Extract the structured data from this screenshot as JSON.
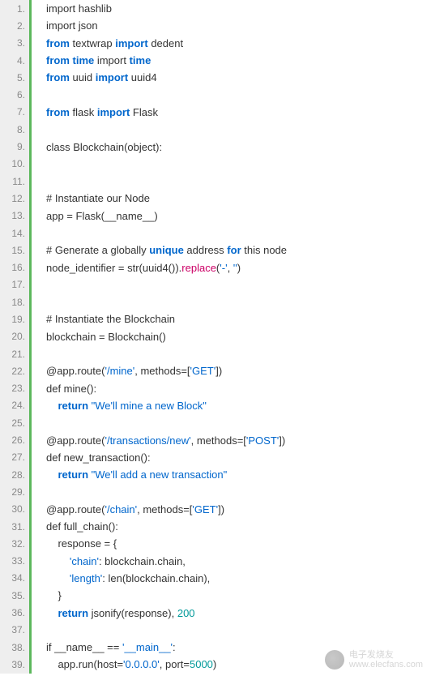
{
  "watermark": {
    "line1": "电子发烧友",
    "line2": "www.elecfans.com"
  },
  "lines": [
    {
      "n": "1.",
      "segs": [
        {
          "t": "import hashlib",
          "c": "plain"
        }
      ]
    },
    {
      "n": "2.",
      "segs": [
        {
          "t": "import json",
          "c": "plain"
        }
      ]
    },
    {
      "n": "3.",
      "segs": [
        {
          "t": "from ",
          "c": "kw"
        },
        {
          "t": "textwrap ",
          "c": "plain"
        },
        {
          "t": "import",
          "c": "kw2"
        },
        {
          "t": " dedent",
          "c": "plain"
        }
      ]
    },
    {
      "n": "4.",
      "segs": [
        {
          "t": "from time ",
          "c": "kw"
        },
        {
          "t": "import ",
          "c": "plain"
        },
        {
          "t": "time",
          "c": "kw3"
        }
      ]
    },
    {
      "n": "5.",
      "segs": [
        {
          "t": "from ",
          "c": "kw"
        },
        {
          "t": "uuid ",
          "c": "plain"
        },
        {
          "t": "import",
          "c": "kw2"
        },
        {
          "t": " uuid4",
          "c": "plain"
        }
      ]
    },
    {
      "n": "6.",
      "segs": [
        {
          "t": "",
          "c": "plain"
        }
      ]
    },
    {
      "n": "7.",
      "segs": [
        {
          "t": "from ",
          "c": "kw"
        },
        {
          "t": "flask ",
          "c": "plain"
        },
        {
          "t": "import",
          "c": "kw2"
        },
        {
          "t": " Flask",
          "c": "plain"
        }
      ]
    },
    {
      "n": "8.",
      "segs": [
        {
          "t": "",
          "c": "plain"
        }
      ]
    },
    {
      "n": "9.",
      "segs": [
        {
          "t": "class Blockchain(object):",
          "c": "plain"
        }
      ]
    },
    {
      "n": "10.",
      "segs": [
        {
          "t": "",
          "c": "plain"
        }
      ]
    },
    {
      "n": "11.",
      "segs": [
        {
          "t": "",
          "c": "plain"
        }
      ]
    },
    {
      "n": "12.",
      "segs": [
        {
          "t": "# Instantiate our Node",
          "c": "plain"
        }
      ]
    },
    {
      "n": "13.",
      "segs": [
        {
          "t": "app = Flask(__name__)",
          "c": "plain"
        }
      ]
    },
    {
      "n": "14.",
      "segs": [
        {
          "t": "",
          "c": "plain"
        }
      ]
    },
    {
      "n": "15.",
      "segs": [
        {
          "t": "# Generate a globally ",
          "c": "plain"
        },
        {
          "t": "unique",
          "c": "kw"
        },
        {
          "t": " address ",
          "c": "plain"
        },
        {
          "t": "for",
          "c": "kw"
        },
        {
          "t": " this node",
          "c": "plain"
        }
      ]
    },
    {
      "n": "16.",
      "segs": [
        {
          "t": "node_identifier = str(uuid4()).",
          "c": "plain"
        },
        {
          "t": "replace",
          "c": "fn"
        },
        {
          "t": "(",
          "c": "plain"
        },
        {
          "t": "'-'",
          "c": "str"
        },
        {
          "t": ", ",
          "c": "plain"
        },
        {
          "t": "''",
          "c": "str"
        },
        {
          "t": ")",
          "c": "plain"
        }
      ]
    },
    {
      "n": "17.",
      "segs": [
        {
          "t": "",
          "c": "plain"
        }
      ]
    },
    {
      "n": "18.",
      "segs": [
        {
          "t": "",
          "c": "plain"
        }
      ]
    },
    {
      "n": "19.",
      "segs": [
        {
          "t": "# Instantiate the Blockchain",
          "c": "plain"
        }
      ]
    },
    {
      "n": "20.",
      "segs": [
        {
          "t": "blockchain = Blockchain()",
          "c": "plain"
        }
      ]
    },
    {
      "n": "21.",
      "segs": [
        {
          "t": "",
          "c": "plain"
        }
      ]
    },
    {
      "n": "22.",
      "segs": [
        {
          "t": "@app.route(",
          "c": "plain"
        },
        {
          "t": "'/mine'",
          "c": "str"
        },
        {
          "t": ", methods=[",
          "c": "plain"
        },
        {
          "t": "'GET'",
          "c": "str"
        },
        {
          "t": "])",
          "c": "plain"
        }
      ]
    },
    {
      "n": "23.",
      "segs": [
        {
          "t": "def mine():",
          "c": "plain"
        }
      ]
    },
    {
      "n": "24.",
      "segs": [
        {
          "t": "    ",
          "c": "plain"
        },
        {
          "t": "return ",
          "c": "kw"
        },
        {
          "t": "\"We'll mine a new Block\"",
          "c": "str2"
        }
      ]
    },
    {
      "n": "25.",
      "segs": [
        {
          "t": "",
          "c": "plain"
        }
      ]
    },
    {
      "n": "26.",
      "segs": [
        {
          "t": "@app.route(",
          "c": "plain"
        },
        {
          "t": "'/transactions/new'",
          "c": "str"
        },
        {
          "t": ", methods=[",
          "c": "plain"
        },
        {
          "t": "'POST'",
          "c": "str"
        },
        {
          "t": "])",
          "c": "plain"
        }
      ]
    },
    {
      "n": "27.",
      "segs": [
        {
          "t": "def new_transaction():",
          "c": "plain"
        }
      ]
    },
    {
      "n": "28.",
      "segs": [
        {
          "t": "    ",
          "c": "plain"
        },
        {
          "t": "return ",
          "c": "kw"
        },
        {
          "t": "\"We'll add a new transaction\"",
          "c": "str2"
        }
      ]
    },
    {
      "n": "29.",
      "segs": [
        {
          "t": "",
          "c": "plain"
        }
      ]
    },
    {
      "n": "30.",
      "segs": [
        {
          "t": "@app.route(",
          "c": "plain"
        },
        {
          "t": "'/chain'",
          "c": "str"
        },
        {
          "t": ", methods=[",
          "c": "plain"
        },
        {
          "t": "'GET'",
          "c": "str"
        },
        {
          "t": "])",
          "c": "plain"
        }
      ]
    },
    {
      "n": "31.",
      "segs": [
        {
          "t": "def full_chain():",
          "c": "plain"
        }
      ]
    },
    {
      "n": "32.",
      "segs": [
        {
          "t": "    response = {",
          "c": "plain"
        }
      ]
    },
    {
      "n": "33.",
      "segs": [
        {
          "t": "        ",
          "c": "plain"
        },
        {
          "t": "'chain'",
          "c": "str"
        },
        {
          "t": ": blockchain.chain,",
          "c": "plain"
        }
      ]
    },
    {
      "n": "34.",
      "segs": [
        {
          "t": "        ",
          "c": "plain"
        },
        {
          "t": "'length'",
          "c": "str"
        },
        {
          "t": ": len(blockchain.chain),",
          "c": "plain"
        }
      ]
    },
    {
      "n": "35.",
      "segs": [
        {
          "t": "    }",
          "c": "plain"
        }
      ]
    },
    {
      "n": "36.",
      "segs": [
        {
          "t": "    ",
          "c": "plain"
        },
        {
          "t": "return ",
          "c": "kw"
        },
        {
          "t": "jsonify(response), ",
          "c": "plain"
        },
        {
          "t": "200",
          "c": "num"
        }
      ]
    },
    {
      "n": "37.",
      "segs": [
        {
          "t": "",
          "c": "plain"
        }
      ]
    },
    {
      "n": "38.",
      "segs": [
        {
          "t": "if __name__ == ",
          "c": "plain"
        },
        {
          "t": "'__main__'",
          "c": "str"
        },
        {
          "t": ":",
          "c": "plain"
        }
      ]
    },
    {
      "n": "39.",
      "segs": [
        {
          "t": "    app.run(host=",
          "c": "plain"
        },
        {
          "t": "'0.0.0.0'",
          "c": "str"
        },
        {
          "t": ", port=",
          "c": "plain"
        },
        {
          "t": "5000",
          "c": "num"
        },
        {
          "t": ")",
          "c": "plain"
        }
      ]
    }
  ]
}
